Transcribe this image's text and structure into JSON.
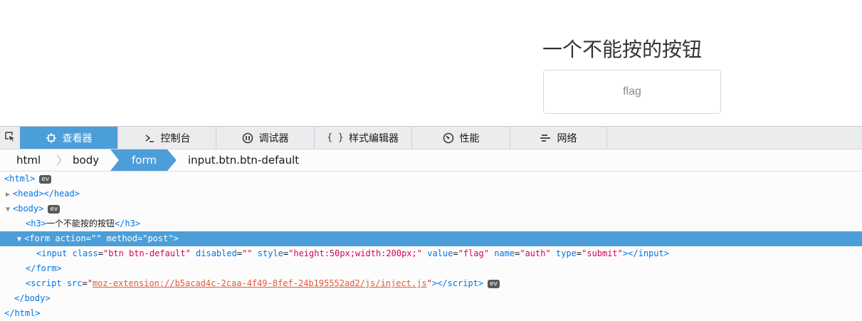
{
  "webpage": {
    "heading": "一个不能按的按钮",
    "button_value": "flag"
  },
  "toolbar": {
    "tabs": [
      {
        "label": "查看器",
        "icon": "inspector-icon",
        "selected": true
      },
      {
        "label": "控制台",
        "icon": "console-icon",
        "selected": false
      },
      {
        "label": "调试器",
        "icon": "debugger-icon",
        "selected": false
      },
      {
        "label": "样式编辑器",
        "icon": "braces-icon",
        "selected": false
      },
      {
        "label": "性能",
        "icon": "performance-icon",
        "selected": false
      },
      {
        "label": "网络",
        "icon": "network-icon",
        "selected": false
      }
    ]
  },
  "breadcrumbs": {
    "items": [
      "html",
      "body",
      "form",
      "input.btn.btn-default"
    ],
    "active_index": 2
  },
  "markup": {
    "html_open": "html",
    "head": "head",
    "body": "body",
    "h3_tag": "h3",
    "h3_text": "一个不能按的按钮",
    "form_tag": "form",
    "form_action_attr": "action",
    "form_action_val": "",
    "form_method_attr": "method",
    "form_method_val": "post",
    "input_tag": "input",
    "input_attrs": [
      {
        "name": "class",
        "value": "btn btn-default"
      },
      {
        "name": "disabled",
        "value": ""
      },
      {
        "name": "style",
        "value": "height:50px;width:200px;"
      },
      {
        "name": "value",
        "value": "flag"
      },
      {
        "name": "name",
        "value": "auth"
      },
      {
        "name": "type",
        "value": "submit"
      }
    ],
    "script_tag": "script",
    "script_src_attr": "src",
    "script_src_val": "moz-extension://b5acad4c-2caa-4f49-8fef-24b195552ad2/js/inject.js",
    "ev_badge": "ev"
  },
  "colors": {
    "accent": "#4c9ed9",
    "tag": "#0074e8",
    "attr_value": "#d7005f",
    "link": "#e25a3b"
  }
}
